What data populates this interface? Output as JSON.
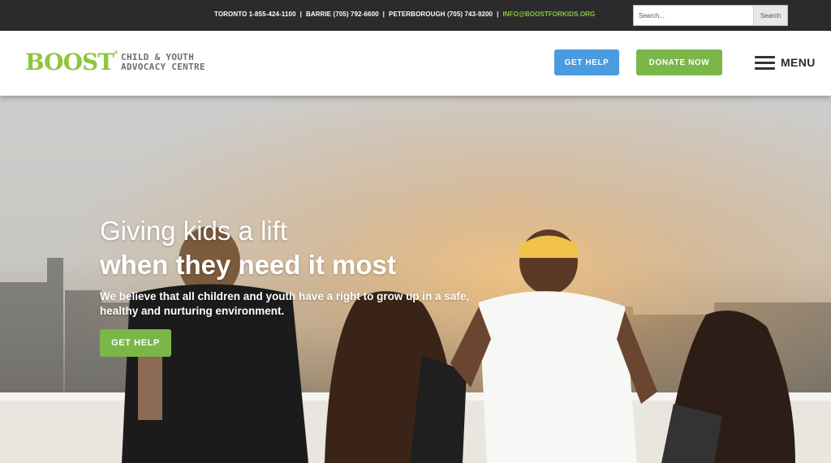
{
  "topbar": {
    "toronto": "TORONTO 1-855-424-1100",
    "barrie": "BARRIE (705) 792-6600",
    "peterborough": "PETERBOROUGH (705) 743-9200",
    "separator": "|",
    "email": "INFO@BOOSTFORKIDS.ORG",
    "search_placeholder": "Search...",
    "search_button": "Search"
  },
  "header": {
    "logo_word": "BOOST",
    "logo_trademark": "®",
    "logo_line1": "CHILD & YOUTH",
    "logo_line2": "ADVOCACY CENTRE",
    "get_help": "GET HELP",
    "donate": "DONATE NOW",
    "menu_label": "MENU",
    "menu_icon": "hamburger-icon"
  },
  "hero": {
    "line1": "Giving kids a lift",
    "line2": "when they need it most",
    "description": "We believe that all children and youth have a right to grow up in a safe, healthy and nurturing environment.",
    "button": "GET HELP"
  },
  "colors": {
    "topbar_bg": "#2b2b2b",
    "brand_green": "#7ab648",
    "email_green": "#8dc63f",
    "help_blue": "#4a9be0",
    "logo_gray": "#6d6e71"
  }
}
